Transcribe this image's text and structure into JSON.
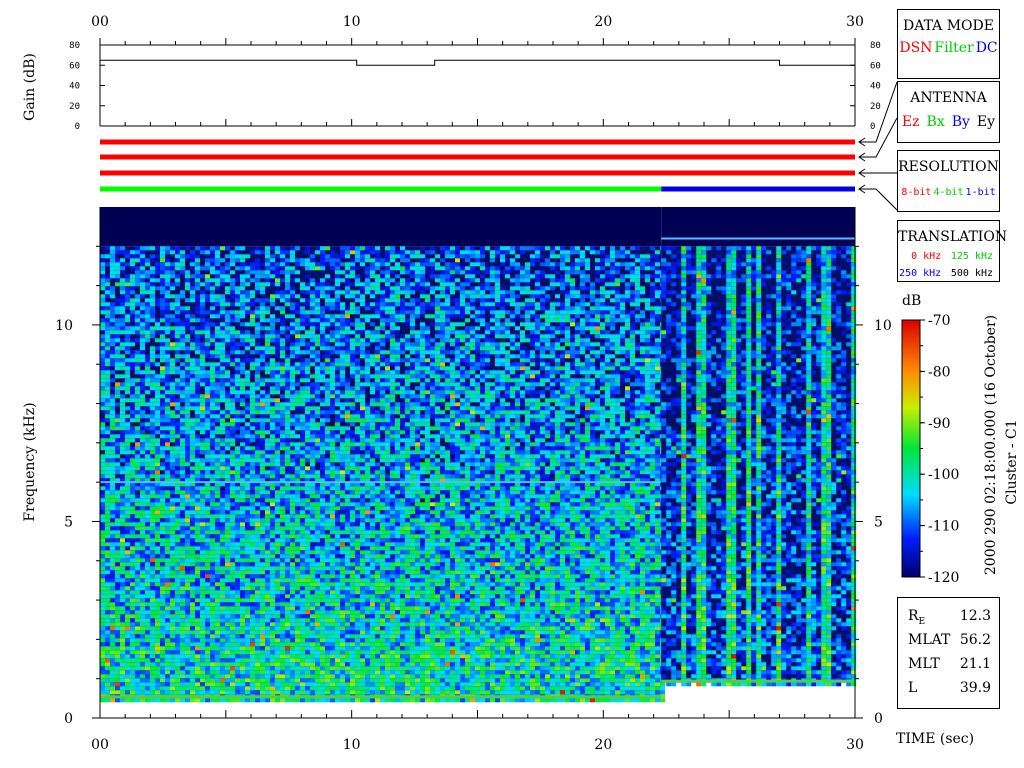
{
  "x_axis": {
    "ticks": [
      "00",
      "10",
      "20",
      "30"
    ],
    "label": "TIME (sec)"
  },
  "gain_panel": {
    "ylabel": "Gain (dB)",
    "ticks": [
      "80",
      "60",
      "40",
      "20",
      "0"
    ]
  },
  "freq_panel": {
    "ylabel": "Frequency (kHz)",
    "ticks": [
      "10",
      "5",
      "0"
    ]
  },
  "colorbar": {
    "title": "dB",
    "ticks": [
      "-70",
      "-80",
      "-90",
      "-100",
      "-110",
      "-120"
    ]
  },
  "side_caption": "2000 290 02:18:00.000 (16 October)",
  "spacecraft": "Cluster - C1",
  "legend_boxes": {
    "data_mode": {
      "title": "DATA MODE",
      "items": [
        {
          "label": "DSN",
          "color": "#ff0000"
        },
        {
          "label": "Filter",
          "color": "#00cc00"
        },
        {
          "label": "DC",
          "color": "#0000ff"
        }
      ]
    },
    "antenna": {
      "title": "ANTENNA",
      "items": [
        {
          "label": "Ez",
          "color": "#ff0000"
        },
        {
          "label": "Bx",
          "color": "#00cc00"
        },
        {
          "label": "By",
          "color": "#0000ff"
        },
        {
          "label": "Ey",
          "color": "#000000"
        }
      ]
    },
    "resolution": {
      "title": "RESOLUTION",
      "items": [
        {
          "label": "8-bit",
          "color": "#ff0000"
        },
        {
          "label": "4-bit",
          "color": "#00cc00"
        },
        {
          "label": "1-bit",
          "color": "#0000ff"
        }
      ]
    },
    "translation": {
      "title": "TRANSLATION",
      "items": [
        {
          "label": "0 kHz",
          "color": "#ff0000"
        },
        {
          "label": "125 kHz",
          "color": "#00cc00"
        },
        {
          "label": "250 kHz",
          "color": "#0000ff"
        },
        {
          "label": "500 kHz",
          "color": "#000000"
        }
      ]
    }
  },
  "orbit_info": [
    {
      "key": "R_E",
      "value": "12.3"
    },
    {
      "key": "MLAT",
      "value": "56.2"
    },
    {
      "key": "MLT",
      "value": "21.1"
    },
    {
      "key": "L",
      "value": "39.9"
    }
  ],
  "chart_data": {
    "type": "heatmap",
    "title": "",
    "xlabel": "TIME (sec)",
    "ylabel": "Frequency (kHz)",
    "xlim": [
      0,
      30
    ],
    "ylim": [
      0,
      13
    ],
    "x_ticks": [
      0,
      10,
      20,
      30
    ],
    "y_ticks": [
      0,
      5,
      10
    ],
    "colorbar": {
      "label": "dB",
      "range": [
        -120,
        -70
      ],
      "ticks": [
        -70,
        -80,
        -90,
        -100,
        -110,
        -120
      ]
    },
    "gain": {
      "ylim": [
        0,
        80
      ],
      "y_ticks": [
        0,
        20,
        40,
        60,
        80
      ],
      "segments": [
        {
          "x": [
            0,
            10.2
          ],
          "value": 65
        },
        {
          "x": [
            10.2,
            13.3
          ],
          "value": 60
        },
        {
          "x": [
            13.3,
            27
          ],
          "value": 65
        },
        {
          "x": [
            27,
            30
          ],
          "value": 60
        }
      ]
    },
    "status_bars": [
      {
        "name": "DATA MODE",
        "segments": [
          {
            "x": [
              0,
              30
            ],
            "color": "#ff0000"
          }
        ]
      },
      {
        "name": "ANTENNA",
        "segments": [
          {
            "x": [
              0,
              30
            ],
            "color": "#ff0000"
          }
        ]
      },
      {
        "name": "RESOLUTION",
        "segments": [
          {
            "x": [
              0,
              30
            ],
            "color": "#ff0000"
          }
        ]
      },
      {
        "name": "TRANSLATION",
        "segments": [
          {
            "x": [
              0,
              22.3
            ],
            "color": "#00ff00"
          },
          {
            "x": [
              22.3,
              30
            ],
            "color": "#0000dd"
          }
        ]
      }
    ],
    "regimes": [
      {
        "x": [
          0,
          22.3
        ],
        "freq_range_kHz": [
          0.5,
          12.0
        ],
        "line_kHz": 6.0
      },
      {
        "x": [
          22.3,
          30
        ],
        "freq_range_kHz": [
          0.9,
          12.0
        ],
        "line_kHz": 12.2
      }
    ]
  }
}
